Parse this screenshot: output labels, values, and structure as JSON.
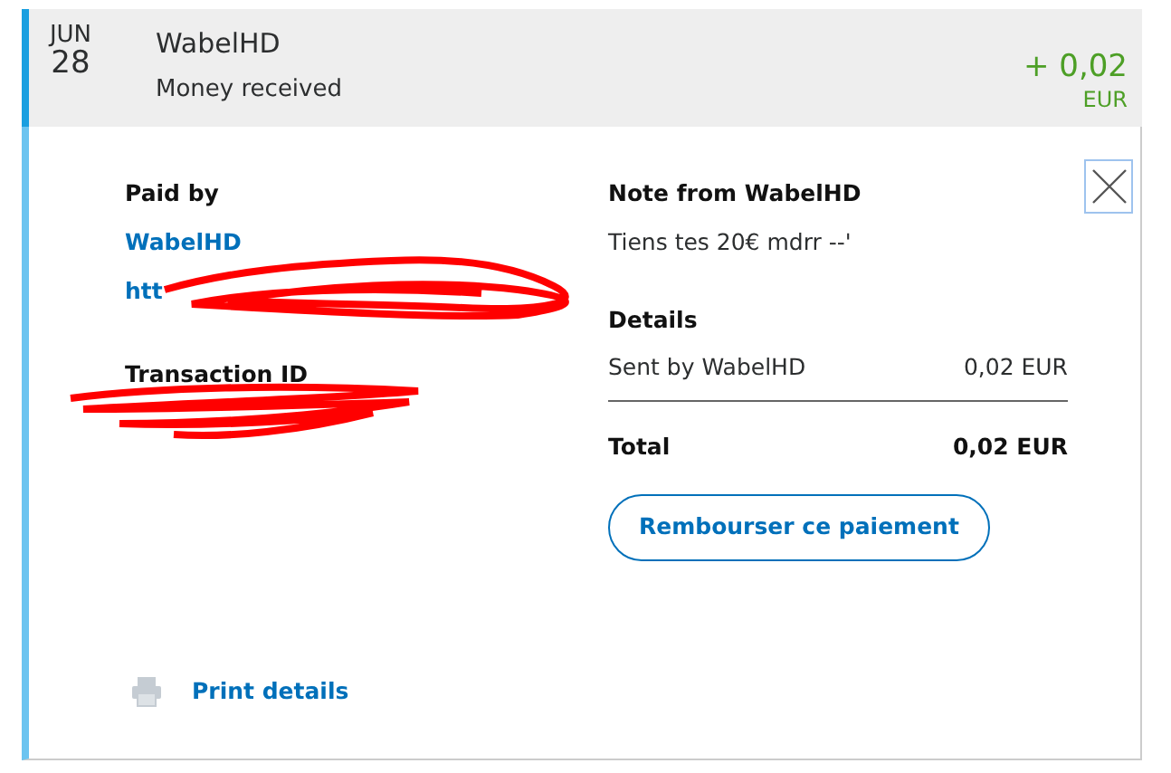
{
  "transaction": {
    "month": "JUN",
    "day": "28",
    "name": "WabelHD",
    "type": "Money received",
    "amount": "+ 0,02",
    "currency": "EUR",
    "expanded": true
  },
  "paid_by": {
    "heading": "Paid by",
    "name": "WabelHD",
    "link": "htt"
  },
  "transaction_id": {
    "heading": "Transaction ID"
  },
  "note": {
    "heading": "Note from WabelHD",
    "text": "Tiens tes 20€ mdrr --'"
  },
  "details": {
    "heading": "Details",
    "lines": [
      {
        "label": "Sent by WabelHD",
        "value": "0,02 EUR"
      }
    ],
    "total": {
      "label": "Total",
      "value": "0,02 EUR"
    }
  },
  "refund_button": "Rembourser ce paiement",
  "print_link": "Print details"
}
